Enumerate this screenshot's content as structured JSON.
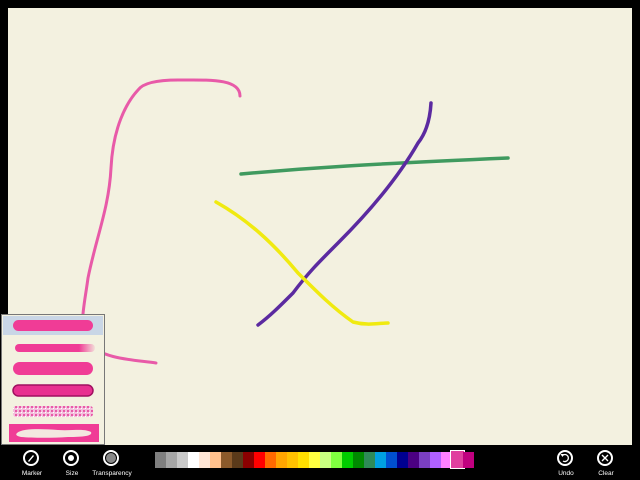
{
  "toolbar": {
    "marker_label": "Marker",
    "size_label": "Size",
    "transparency_label": "Transparency",
    "undo_label": "Undo",
    "clear_label": "Clear"
  },
  "icons": [
    "marker-icon",
    "size-icon",
    "transparency-icon",
    "undo-icon",
    "clear-icon"
  ],
  "palette": [
    "#000000",
    "#7f7f7f",
    "#a6a6a6",
    "#c9c9c9",
    "#ffffff",
    "#ffe6d6",
    "#ffc08c",
    "#8b5a2b",
    "#5a3a1a",
    "#8b0000",
    "#ff0000",
    "#ff6a00",
    "#ffa500",
    "#ffc000",
    "#ffe000",
    "#ffff40",
    "#c8ff80",
    "#80ff40",
    "#00cc00",
    "#008a00",
    "#2e8b57",
    "#00a0e0",
    "#0050d0",
    "#000090",
    "#4b0082",
    "#7a3fc0",
    "#b060ff",
    "#ff80ff",
    "#e0409f",
    "#c0007f"
  ],
  "selected_color": "#e0409f",
  "strokes": [
    {
      "color": "#e85aa8",
      "name": "pink-stroke"
    },
    {
      "color": "#3f9a5f",
      "name": "green-stroke"
    },
    {
      "color": "#5b2aa0",
      "name": "purple-stroke"
    },
    {
      "color": "#f0ea10",
      "name": "yellow-stroke"
    }
  ],
  "brush_styles": [
    "marker",
    "airbrush",
    "pen",
    "calligraphy",
    "crayon",
    "highlighter"
  ]
}
